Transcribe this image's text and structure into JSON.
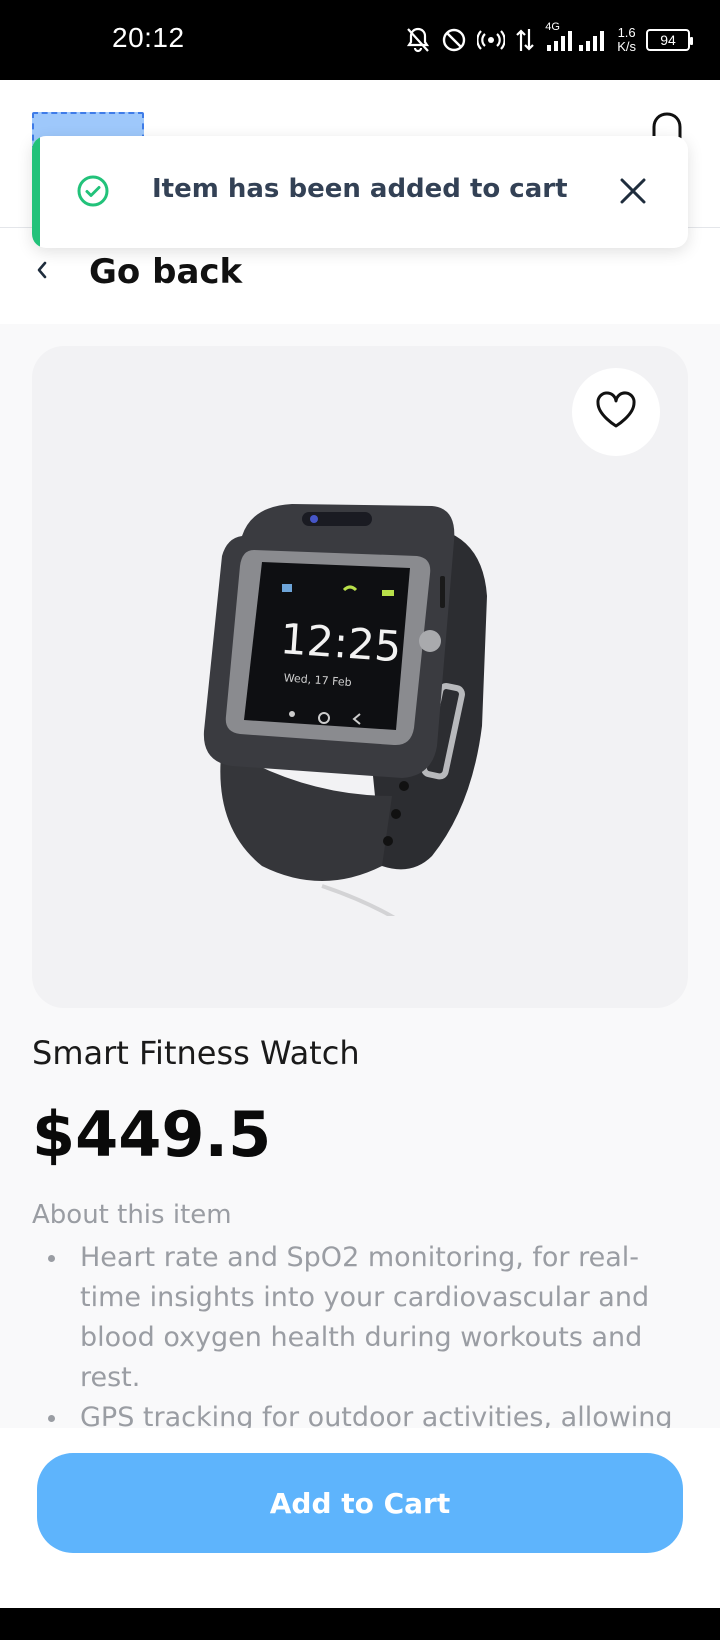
{
  "status_bar": {
    "time": "20:12",
    "network_type": "4G",
    "speed_value": "1.6",
    "speed_unit": "K/s",
    "battery": "94"
  },
  "toast": {
    "message": "Item has been added to cart",
    "accent_color": "#22c27a"
  },
  "nav": {
    "back_label": "Go back"
  },
  "product": {
    "name": "Smart Fitness Watch",
    "price": "$449.5",
    "about_title": "About this item",
    "features": [
      "Heart rate and SpO2 monitoring,  for real-time insights into your cardiovascular and blood oxygen health during workouts and rest.",
      "GPS tracking for outdoor activities, allowing accurate distance, pace, and route mapping"
    ],
    "watch_screen_time": "12:25",
    "watch_screen_date": "Wed, 17 Feb"
  },
  "actions": {
    "add_to_cart": "Add to Cart",
    "button_color": "#5eb4fc"
  },
  "icons": [
    "bell-off-icon",
    "dnd-icon",
    "hotspot-icon",
    "data-transfer-icon",
    "signal-icon",
    "battery-icon",
    "bell-icon",
    "check-circle-icon",
    "close-icon",
    "chevron-left-icon",
    "heart-icon"
  ]
}
